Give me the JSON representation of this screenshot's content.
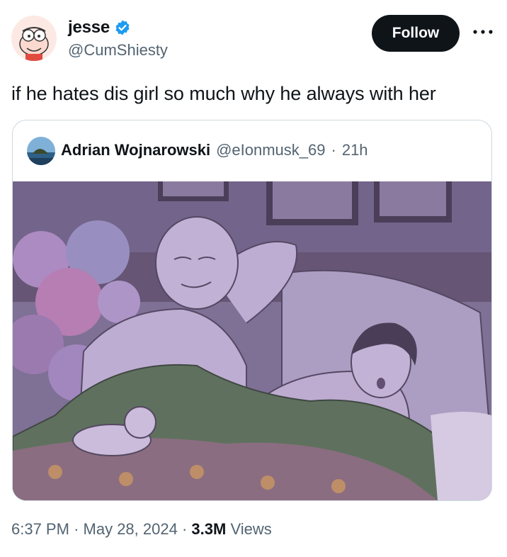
{
  "author": {
    "name": "jesse",
    "handle": "@CumShiesty",
    "verified_icon": "verified-badge-icon",
    "avatar_icon": "peter-griffin-avatar-icon"
  },
  "actions": {
    "follow_label": "Follow",
    "more_icon": "more-dots-icon"
  },
  "tweet": {
    "text": "if he hates dis girl so much why he always with her"
  },
  "quoted": {
    "name": "Adrian Wojnarowski",
    "handle": "@eIonmusk_69",
    "separator": "·",
    "time": "21h",
    "avatar_icon": "island-landscape-avatar-icon",
    "image_icon": "cartoon-wojak-in-bed-image"
  },
  "meta": {
    "time": "6:37 PM",
    "date": "May 28, 2024",
    "views_count": "3.3M",
    "views_label": "Views",
    "sep1": "·",
    "sep2": "·"
  },
  "colors": {
    "accent": "#0f1419",
    "secondary": "#536471",
    "verified": "#1d9bf0",
    "border": "#cfd9de",
    "image_tint": "#8c7ba8"
  }
}
